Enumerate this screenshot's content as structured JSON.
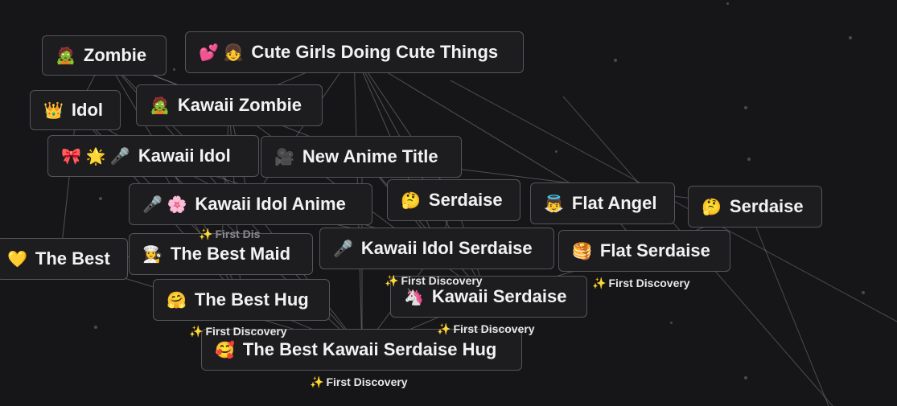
{
  "tiles": [
    {
      "id": "zombie",
      "emoji": "🧟",
      "label": "Zombie"
    },
    {
      "id": "cgdct",
      "emoji": "💕 👧",
      "label": "Cute Girls Doing Cute Things"
    },
    {
      "id": "idol",
      "emoji": "👑",
      "label": "Idol"
    },
    {
      "id": "kawaii-zombie",
      "emoji": "🧟",
      "label": "Kawaii Zombie"
    },
    {
      "id": "kawaii-idol",
      "emoji": "🎀 🌟 🎤",
      "label": "Kawaii Idol"
    },
    {
      "id": "new-anime-title",
      "emoji": "🎥",
      "label": "New Anime Title"
    },
    {
      "id": "kawaii-idol-anime",
      "emoji": "🎤 🌸",
      "label": "Kawaii Idol Anime"
    },
    {
      "id": "serdaise-1",
      "emoji": "🤔",
      "label": "Serdaise"
    },
    {
      "id": "flat-angel",
      "emoji": "👼",
      "label": "Flat Angel"
    },
    {
      "id": "serdaise-2",
      "emoji": "🤔",
      "label": "Serdaise"
    },
    {
      "id": "the-best",
      "emoji": "💛",
      "label": "The Best"
    },
    {
      "id": "the-best-maid",
      "emoji": "👩‍🍳",
      "label": "The Best Maid"
    },
    {
      "id": "kawaii-idol-serdaise",
      "emoji": "🎤",
      "label": "Kawaii Idol Serdaise"
    },
    {
      "id": "flat-serdaise",
      "emoji": "🥞",
      "label": "Flat Serdaise"
    },
    {
      "id": "the-best-hug",
      "emoji": "🤗",
      "label": "The Best Hug"
    },
    {
      "id": "kawaii-serdaise",
      "emoji": "🦄",
      "label": "Kawaii Serdaise"
    },
    {
      "id": "best-kawaii-serdaise-hug",
      "emoji": "🥰",
      "label": "The Best Kawaii Serdaise Hug"
    }
  ],
  "badges": [
    {
      "id": "b1",
      "spark": "✨",
      "label": "First Discovery"
    },
    {
      "id": "b2",
      "spark": "✨",
      "label": "First Discovery"
    },
    {
      "id": "b3",
      "spark": "✨",
      "label": "First Discovery"
    },
    {
      "id": "b4",
      "spark": "✨",
      "label": "First Discovery"
    },
    {
      "id": "b5",
      "spark": "✨",
      "label": "First Discovery"
    },
    {
      "id": "b6",
      "spark": "✨",
      "label": "First Dis"
    }
  ],
  "colors": {
    "background": "#161618",
    "tile": "#1d1d20",
    "tile_border": "#55555a",
    "lines": "#9a9aa0"
  }
}
